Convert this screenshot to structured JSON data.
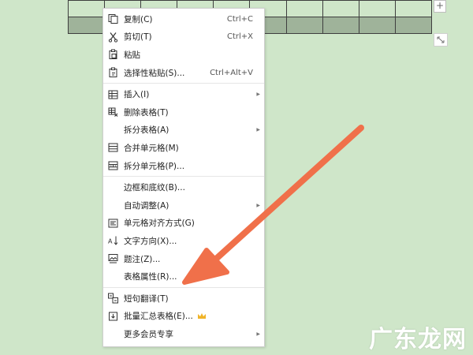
{
  "menu": {
    "groups": [
      [
        {
          "icon": "copy-icon",
          "label": "复制(C)",
          "shortcut": "Ctrl+C"
        },
        {
          "icon": "scissors-icon",
          "label": "剪切(T)",
          "shortcut": "Ctrl+X"
        },
        {
          "icon": "paste-icon",
          "label": "粘贴",
          "shortcut": ""
        },
        {
          "icon": "paste-special-icon",
          "label": "选择性粘贴(S)...",
          "shortcut": "Ctrl+Alt+V"
        }
      ],
      [
        {
          "icon": "table-insert-icon",
          "label": "插入(I)",
          "submenu": true
        },
        {
          "icon": "table-delete-icon",
          "label": "删除表格(T)"
        },
        {
          "icon": "",
          "label": "拆分表格(A)",
          "submenu": true
        },
        {
          "icon": "merge-cells-icon",
          "label": "合并单元格(M)"
        },
        {
          "icon": "split-cells-icon",
          "label": "拆分单元格(P)..."
        }
      ],
      [
        {
          "icon": "",
          "label": "边框和底纹(B)..."
        },
        {
          "icon": "",
          "label": "自动调整(A)",
          "submenu": true
        },
        {
          "icon": "cell-align-icon",
          "label": "单元格对齐方式(G)",
          "submenu": true
        },
        {
          "icon": "text-direction-icon",
          "label": "文字方向(X)..."
        },
        {
          "icon": "caption-icon",
          "label": "题注(Z)..."
        },
        {
          "icon": "",
          "label": "表格属性(R)..."
        }
      ],
      [
        {
          "icon": "translate-icon",
          "label": "短句翻译(T)"
        },
        {
          "icon": "batch-table-icon",
          "label": "批量汇总表格(E)...",
          "crown": true
        },
        {
          "icon": "",
          "label": "更多会员专享",
          "submenu": true
        }
      ]
    ]
  },
  "handles": {
    "plus": "+"
  },
  "watermark": "广东龙网",
  "colors": {
    "background": "#cfe6c9",
    "arrow": "#f0704a",
    "crown": "#f0b429"
  }
}
